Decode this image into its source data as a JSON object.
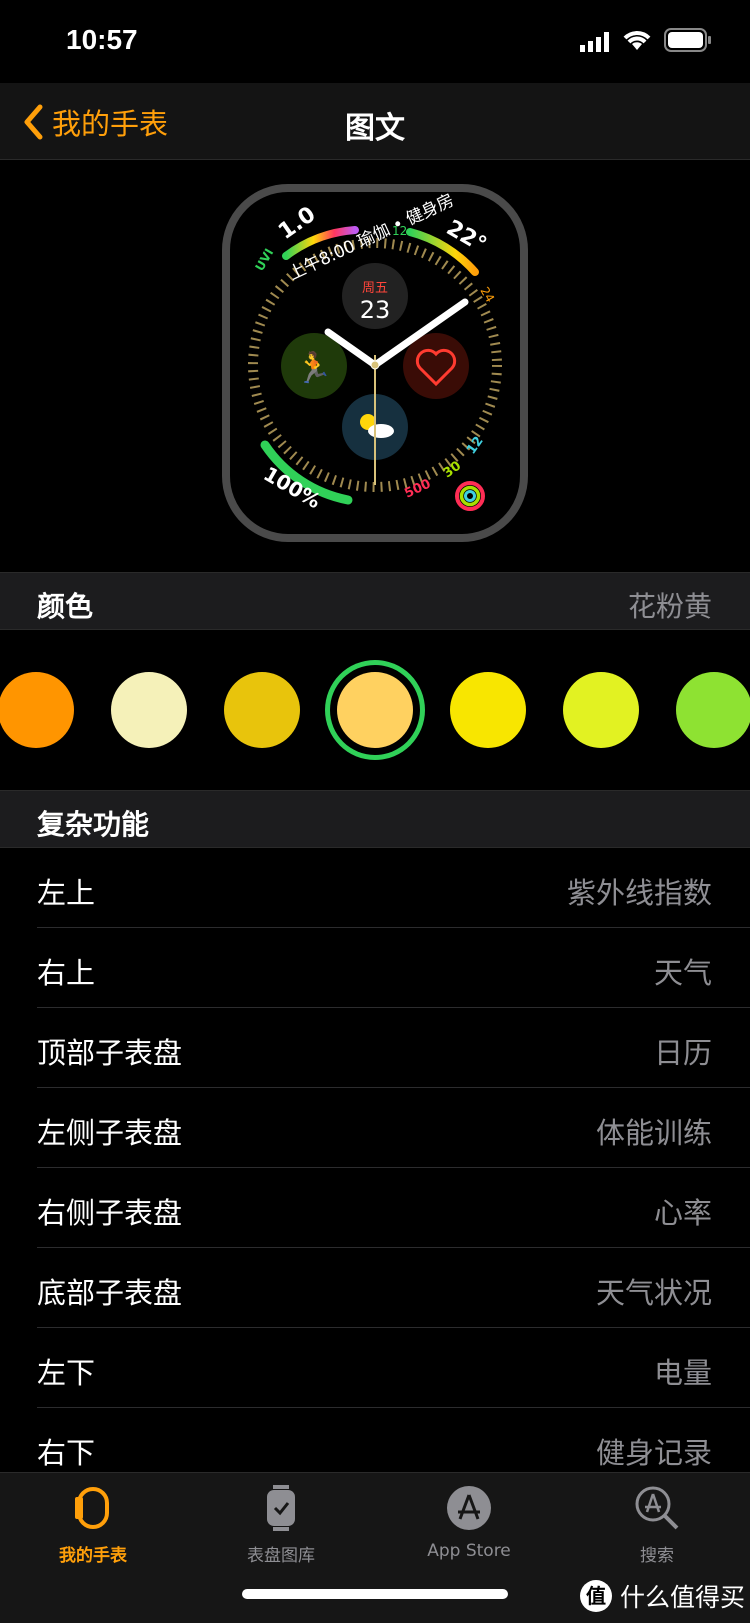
{
  "status_bar": {
    "time": "10:57"
  },
  "nav": {
    "back_label": "我的手表",
    "title": "图文"
  },
  "watch_face": {
    "uv_value": "1.0",
    "uv_label": "UVI",
    "temperature": "22°",
    "temp_low": "12",
    "temp_high": "24",
    "event": "上午8:00 瑜伽 • 健身房",
    "day": "周五",
    "date": "23",
    "battery": "100%",
    "activity": {
      "move": "500",
      "exercise": "30",
      "stand": "12"
    }
  },
  "color_section": {
    "label": "颜色",
    "value": "花粉黄"
  },
  "swatches": [
    {
      "color": "#FF9500",
      "selected": false
    },
    {
      "color": "#F5F1B9",
      "selected": false
    },
    {
      "color": "#E8C40C",
      "selected": false
    },
    {
      "color": "#FFD160",
      "selected": true
    },
    {
      "color": "#F8E600",
      "selected": false
    },
    {
      "color": "#E2F222",
      "selected": false
    },
    {
      "color": "#8EE232",
      "selected": false
    }
  ],
  "complications": {
    "label": "复杂功能",
    "items": [
      {
        "label": "左上",
        "value": "紫外线指数"
      },
      {
        "label": "右上",
        "value": "天气"
      },
      {
        "label": "顶部子表盘",
        "value": "日历"
      },
      {
        "label": "左侧子表盘",
        "value": "体能训练"
      },
      {
        "label": "右侧子表盘",
        "value": "心率"
      },
      {
        "label": "底部子表盘",
        "value": "天气状况"
      },
      {
        "label": "左下",
        "value": "电量"
      },
      {
        "label": "右下",
        "value": "健身记录"
      }
    ]
  },
  "tabs": [
    {
      "label": "我的手表",
      "icon": "watch-icon"
    },
    {
      "label": "表盘图库",
      "icon": "face-gallery-icon"
    },
    {
      "label": "App Store",
      "icon": "app-store-icon"
    },
    {
      "label": "搜索",
      "icon": "search-icon"
    }
  ],
  "watermark": {
    "badge": "值",
    "text": "什么值得买"
  },
  "colors": {
    "accent": "#FF9F0A",
    "selection_ring": "#30D158"
  }
}
